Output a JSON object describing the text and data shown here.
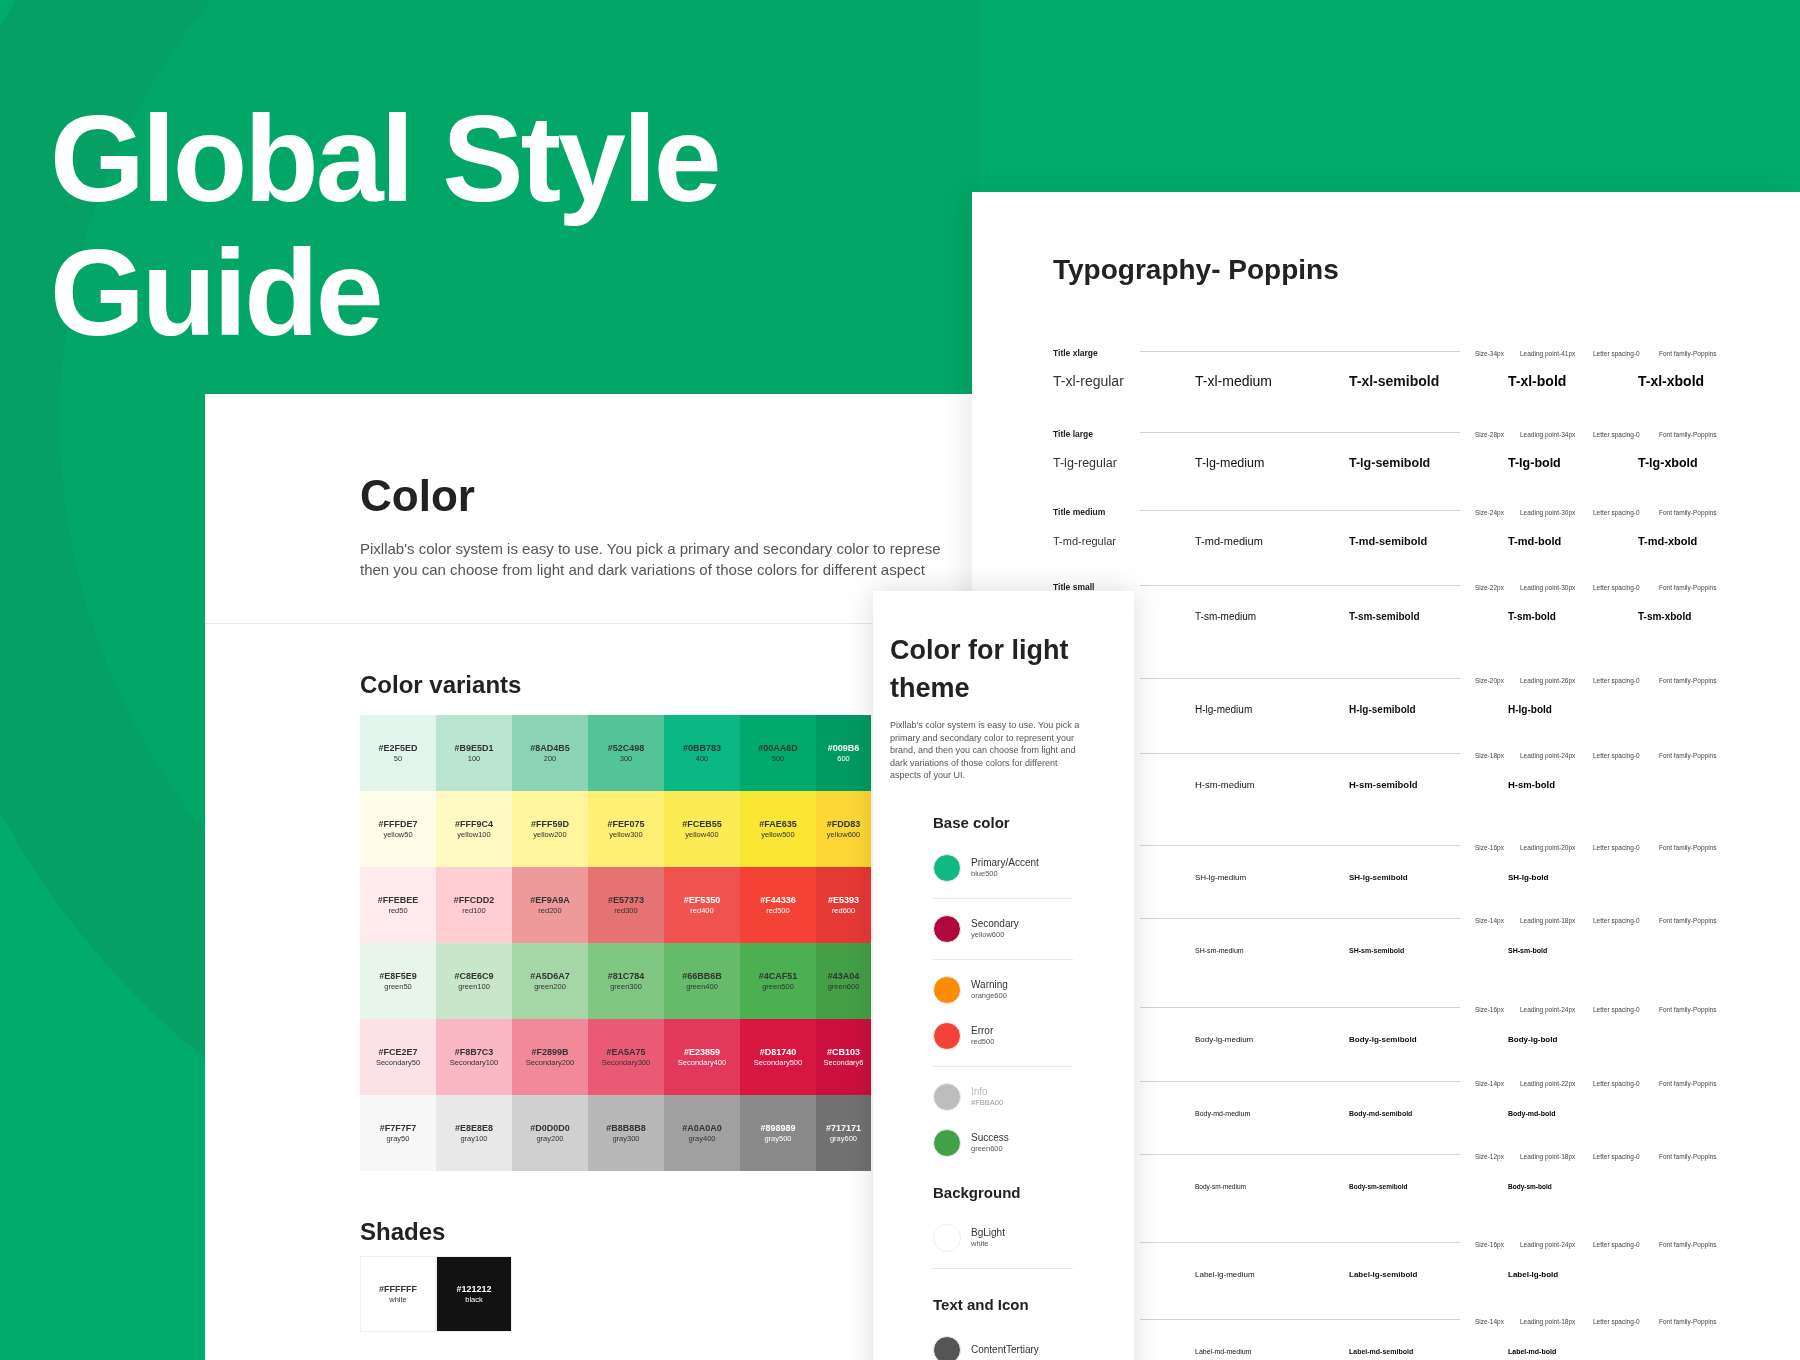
{
  "title": "Global Style Guide",
  "color_panel": {
    "heading": "Color",
    "description_lines": [
      "Pixllab's color system is easy to use. You pick a primary and secondary color to represe",
      "then you can choose from light and dark variations of those colors for different aspect"
    ],
    "variants_heading": "Color variants",
    "rows": [
      {
        "cells": [
          {
            "hex": "#E2F5ED",
            "name": "50",
            "color": "#e2f5ed"
          },
          {
            "hex": "#B9E5D1",
            "name": "100",
            "color": "#b9e5d1"
          },
          {
            "hex": "#8AD4B5",
            "name": "200",
            "color": "#8ad4b5"
          },
          {
            "hex": "#52C498",
            "name": "300",
            "color": "#52c498"
          },
          {
            "hex": "#0BB783",
            "name": "400",
            "color": "#0bb783"
          },
          {
            "hex": "#00AA6D",
            "name": "500",
            "color": "#00aa6d"
          },
          {
            "hex": "#009B6",
            "name": "600",
            "color": "#009b62"
          }
        ]
      },
      {
        "cells": [
          {
            "hex": "#FFFDE7",
            "name": "yellow50",
            "color": "#fffde7"
          },
          {
            "hex": "#FFF9C4",
            "name": "yellow100",
            "color": "#fff9c4"
          },
          {
            "hex": "#FFF59D",
            "name": "yellow200",
            "color": "#fff59d"
          },
          {
            "hex": "#FEF075",
            "name": "yellow300",
            "color": "#fef075"
          },
          {
            "hex": "#FCEB55",
            "name": "yellow400",
            "color": "#fceb55"
          },
          {
            "hex": "#FAE635",
            "name": "yellow500",
            "color": "#fae635"
          },
          {
            "hex": "#FDD83",
            "name": "yellow600",
            "color": "#fdd835"
          }
        ]
      },
      {
        "cells": [
          {
            "hex": "#FFEBEE",
            "name": "red50",
            "color": "#ffebee"
          },
          {
            "hex": "#FFCDD2",
            "name": "red100",
            "color": "#ffcdd2"
          },
          {
            "hex": "#EF9A9A",
            "name": "red200",
            "color": "#ef9a9a"
          },
          {
            "hex": "#E57373",
            "name": "red300",
            "color": "#e57373"
          },
          {
            "hex": "#EF5350",
            "name": "red400",
            "color": "#ef5350"
          },
          {
            "hex": "#F44336",
            "name": "red500",
            "color": "#f44336"
          },
          {
            "hex": "#E5393",
            "name": "red600",
            "color": "#e53935"
          }
        ]
      },
      {
        "cells": [
          {
            "hex": "#E8F5E9",
            "name": "green50",
            "color": "#e8f5e9"
          },
          {
            "hex": "#C8E6C9",
            "name": "green100",
            "color": "#c8e6c9"
          },
          {
            "hex": "#A5D6A7",
            "name": "green200",
            "color": "#a5d6a7"
          },
          {
            "hex": "#81C784",
            "name": "green300",
            "color": "#81c784"
          },
          {
            "hex": "#66BB6B",
            "name": "green400",
            "color": "#66bb6b"
          },
          {
            "hex": "#4CAF51",
            "name": "green500",
            "color": "#4caf51"
          },
          {
            "hex": "#43A04",
            "name": "green600",
            "color": "#43a047"
          }
        ]
      },
      {
        "cells": [
          {
            "hex": "#FCE2E7",
            "name": "Secondary50",
            "color": "#fce2e7"
          },
          {
            "hex": "#F8B7C3",
            "name": "Secondary100",
            "color": "#f8b7c3"
          },
          {
            "hex": "#F2899B",
            "name": "Secondary200",
            "color": "#f2899b"
          },
          {
            "hex": "#EA5A75",
            "name": "Secondary300",
            "color": "#ea5a75"
          },
          {
            "hex": "#E23859",
            "name": "Secondary400",
            "color": "#e23859"
          },
          {
            "hex": "#D81740",
            "name": "Secondary500",
            "color": "#d81740"
          },
          {
            "hex": "#CB103",
            "name": "Secondary6",
            "color": "#cb103f"
          }
        ]
      },
      {
        "cells": [
          {
            "hex": "#F7F7F7",
            "name": "gray50",
            "color": "#f7f7f7"
          },
          {
            "hex": "#E8E8E8",
            "name": "gray100",
            "color": "#e8e8e8"
          },
          {
            "hex": "#D0D0D0",
            "name": "gray200",
            "color": "#d0d0d0"
          },
          {
            "hex": "#B8B8B8",
            "name": "gray300",
            "color": "#b8b8b8"
          },
          {
            "hex": "#A0A0A0",
            "name": "gray400",
            "color": "#a0a0a0"
          },
          {
            "hex": "#898989",
            "name": "gray500",
            "color": "#898989"
          },
          {
            "hex": "#717171",
            "name": "gray600",
            "color": "#717171"
          }
        ]
      }
    ],
    "shades_heading": "Shades",
    "shades": [
      {
        "hex": "#FFFFFF",
        "name": "white",
        "color": "#ffffff"
      },
      {
        "hex": "#121212",
        "name": "black",
        "color": "#121212"
      }
    ]
  },
  "typography": {
    "heading": "Typography- Poppins",
    "rows": [
      {
        "label": "Title xlarge",
        "meta": [
          "Size-34px",
          "Leading point-41px",
          "Letter spacing-0",
          "Font family-Poppins"
        ],
        "samples": [
          {
            "text": "T-xl-regular",
            "kind": "regular"
          },
          {
            "text": "T-xl-medium",
            "kind": "medium"
          },
          {
            "text": "T-xl-semibold",
            "kind": "semibold"
          },
          {
            "text": "T-xl-bold",
            "kind": "bold"
          },
          {
            "text": "T-xl-xbold",
            "kind": "xbold"
          }
        ]
      },
      {
        "label": "Title large",
        "meta": [
          "Size-28px",
          "Leading point-34px",
          "Letter spacing-0",
          "Font family-Poppins"
        ],
        "samples": [
          {
            "text": "T-lg-regular",
            "kind": "regular"
          },
          {
            "text": "T-lg-medium",
            "kind": "medium"
          },
          {
            "text": "T-lg-semibold",
            "kind": "semibold"
          },
          {
            "text": "T-lg-bold",
            "kind": "bold"
          },
          {
            "text": "T-lg-xbold",
            "kind": "xbold"
          }
        ]
      },
      {
        "label": "Title medium",
        "meta": [
          "Size-24px",
          "Leading point-30px",
          "Letter spacing-0",
          "Font family-Poppins"
        ],
        "samples": [
          {
            "text": "T-md-regular",
            "kind": "regular"
          },
          {
            "text": "T-md-medium",
            "kind": "medium"
          },
          {
            "text": "T-md-semibold",
            "kind": "semibold"
          },
          {
            "text": "T-md-bold",
            "kind": "bold"
          },
          {
            "text": "T-md-xbold",
            "kind": "xbold"
          }
        ]
      },
      {
        "label": "Title small",
        "meta": [
          "Size-22px",
          "Leading point-30px",
          "Letter spacing-0",
          "Font family-Poppins"
        ],
        "samples": [
          {
            "text": "T-sm-medium",
            "kind": "medium"
          },
          {
            "text": "T-sm-semibold",
            "kind": "semibold"
          },
          {
            "text": "T-sm-bold",
            "kind": "bold"
          },
          {
            "text": "T-sm-xbold",
            "kind": "xbold"
          }
        ]
      },
      {
        "meta": [
          "Size-20px",
          "Leading point-26px",
          "Letter spacing-0",
          "Font family-Poppins"
        ],
        "samples": [
          {
            "text": "H-lg-medium",
            "kind": "medium"
          },
          {
            "text": "H-lg-semibold",
            "kind": "semibold"
          },
          {
            "text": "H-lg-bold",
            "kind": "bold"
          }
        ]
      },
      {
        "meta": [
          "Size-18px",
          "Leading point-24px",
          "Letter spacing-0",
          "Font family-Poppins"
        ],
        "samples": [
          {
            "text": "H-sm-medium",
            "kind": "medium"
          },
          {
            "text": "H-sm-semibold",
            "kind": "semibold"
          },
          {
            "text": "H-sm-bold",
            "kind": "bold"
          }
        ]
      },
      {
        "meta": [
          "Size-16px",
          "Leading point-20px",
          "Letter spacing-0",
          "Font family-Poppins"
        ],
        "samples": [
          {
            "text": "SH-lg-medium",
            "kind": "medium"
          },
          {
            "text": "SH-lg-semibold",
            "kind": "semibold"
          },
          {
            "text": "SH-lg-bold",
            "kind": "bold"
          }
        ]
      },
      {
        "meta": [
          "Size-14px",
          "Leading point-18px",
          "Letter spacing-0",
          "Font family-Poppins"
        ],
        "samples": [
          {
            "text": "SH-sm-medium",
            "kind": "medium"
          },
          {
            "text": "SH-sm-semibold",
            "kind": "semibold"
          },
          {
            "text": "SH-sm-bold",
            "kind": "bold"
          }
        ]
      },
      {
        "meta": [
          "Size-16px",
          "Leading point-24px",
          "Letter spacing-0",
          "Font family-Poppins"
        ],
        "samples": [
          {
            "text": "Body-lg-medium",
            "kind": "medium"
          },
          {
            "text": "Body-lg-semibold",
            "kind": "semibold"
          },
          {
            "text": "Body-lg-bold",
            "kind": "bold"
          }
        ]
      },
      {
        "meta": [
          "Size-14px",
          "Leading point-22px",
          "Letter spacing-0",
          "Font family-Poppins"
        ],
        "samples": [
          {
            "text": "Body-md-medium",
            "kind": "medium"
          },
          {
            "text": "Body-md-semibold",
            "kind": "semibold"
          },
          {
            "text": "Body-md-bold",
            "kind": "bold"
          }
        ]
      },
      {
        "meta": [
          "Size-12px",
          "Leading point-18px",
          "Letter spacing-0",
          "Font family-Poppins"
        ],
        "samples": [
          {
            "text": "Body-sm-medium",
            "kind": "medium"
          },
          {
            "text": "Body-sm-semibold",
            "kind": "semibold"
          },
          {
            "text": "Body-sm-bold",
            "kind": "bold"
          }
        ]
      },
      {
        "meta": [
          "Size-16px",
          "Leading point-24px",
          "Letter spacing-0",
          "Font family-Poppins"
        ],
        "samples": [
          {
            "text": "Label-lg-medium",
            "kind": "medium"
          },
          {
            "text": "Label-lg-semibold",
            "kind": "semibold"
          },
          {
            "text": "Label-lg-bold",
            "kind": "bold"
          }
        ]
      },
      {
        "meta": [
          "Size-14px",
          "Leading point-18px",
          "Letter spacing-0",
          "Font family-Poppins"
        ],
        "samples": [
          {
            "text": "Label-md-medium",
            "kind": "medium"
          },
          {
            "text": "Label-md-semibold",
            "kind": "semibold"
          },
          {
            "text": "Label-md-bold",
            "kind": "bold"
          }
        ]
      }
    ]
  },
  "theme_panel": {
    "heading": "Color for light theme",
    "description": "Pixllab's color system is easy to use. You pick a primary and secondary color to represent your brand, and then you can choose from light and dark variations of those colors for different aspects of your UI.",
    "sections": [
      {
        "title": "Base color",
        "groups": [
          {
            "divider": true,
            "items": [
              {
                "name": "Primary/Accent",
                "sub": "blue500",
                "color": "#10b981",
                "disabled": false
              }
            ]
          },
          {
            "divider": true,
            "items": [
              {
                "name": "Secondary",
                "sub": "yellow600",
                "color": "#b0083c",
                "disabled": false
              }
            ]
          },
          {
            "divider": true,
            "items": [
              {
                "name": "Warning",
                "sub": "orange600",
                "color": "#fb8c00",
                "disabled": false
              },
              {
                "name": "Error",
                "sub": "red500",
                "color": "#f44336",
                "disabled": false
              }
            ]
          },
          {
            "divider": false,
            "items": [
              {
                "name": "Info",
                "sub": "#FBBA00",
                "color": "#bdbdbd",
                "disabled": true
              },
              {
                "name": "Success",
                "sub": "green600",
                "color": "#43a047",
                "disabled": false
              }
            ]
          }
        ]
      },
      {
        "title": "Background",
        "groups": [
          {
            "divider": true,
            "items": [
              {
                "name": "BgLight",
                "sub": "white",
                "color": "#ffffff",
                "disabled": false
              }
            ]
          }
        ]
      },
      {
        "title": "Text and Icon",
        "groups": [
          {
            "divider": false,
            "items": [
              {
                "name": "ContentTertiary",
                "color": "#555555",
                "disabled": false
              }
            ]
          }
        ]
      }
    ]
  }
}
